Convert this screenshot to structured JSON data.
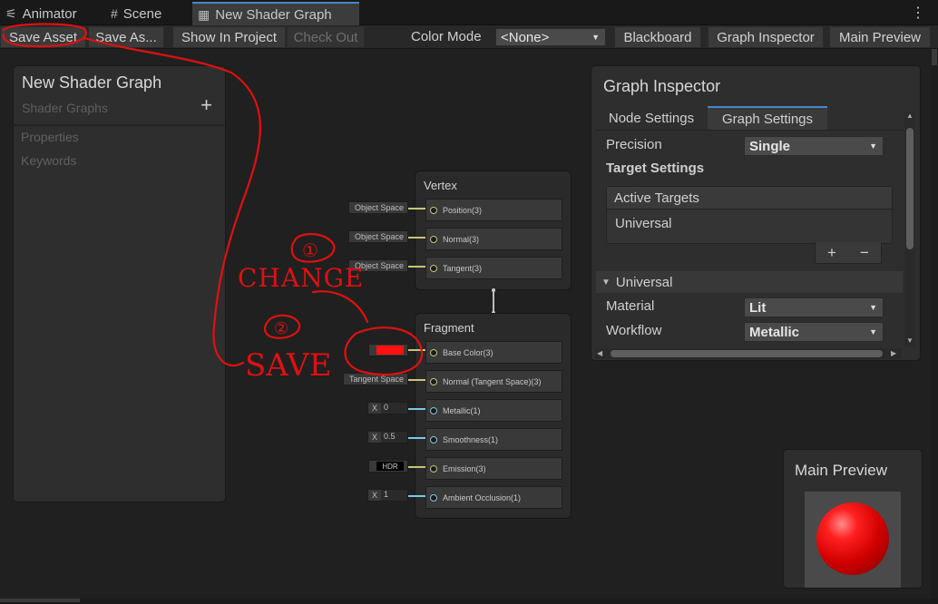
{
  "tabs": [
    {
      "icon": "animator-icon",
      "glyph": "⚟",
      "label": "Animator"
    },
    {
      "icon": "scene-icon",
      "glyph": "#",
      "label": "Scene"
    },
    {
      "icon": "shader-graph-icon",
      "glyph": "▦",
      "label": "New Shader Graph"
    }
  ],
  "toolbar": {
    "save_asset": "Save Asset",
    "save_as": "Save As...",
    "show_in_project": "Show In Project",
    "check_out": "Check Out",
    "color_mode_label": "Color Mode",
    "color_mode_value": "<None>",
    "blackboard": "Blackboard",
    "graph_inspector": "Graph Inspector",
    "main_preview": "Main Preview"
  },
  "blackboard": {
    "title": "New Shader Graph",
    "subtitle": "Shader Graphs",
    "properties": "Properties",
    "keywords": "Keywords"
  },
  "vertex": {
    "title": "Vertex",
    "blocks": [
      {
        "label": "Position(3)",
        "input": "Object Space"
      },
      {
        "label": "Normal(3)",
        "input": "Object Space"
      },
      {
        "label": "Tangent(3)",
        "input": "Object Space"
      }
    ]
  },
  "fragment": {
    "title": "Fragment",
    "blocks": [
      {
        "label": "Base Color(3)",
        "input": "",
        "input_color": "#ff1111"
      },
      {
        "label": "Normal (Tangent Space)(3)",
        "input": "Tangent Space"
      },
      {
        "label": "Metallic(1)",
        "input_prefix": "X",
        "input": "0"
      },
      {
        "label": "Smoothness(1)",
        "input_prefix": "X",
        "input": "0.5"
      },
      {
        "label": "Emission(3)",
        "input": "HDR"
      },
      {
        "label": "Ambient Occlusion(1)",
        "input_prefix": "X",
        "input": "1"
      }
    ]
  },
  "annotations": {
    "step1": "①",
    "step1_text": "CHANGE",
    "step2": "②",
    "step2_text": "SAVE",
    "color": "#e01010"
  },
  "inspector": {
    "title": "Graph Inspector",
    "tab_node": "Node Settings",
    "tab_graph": "Graph Settings",
    "precision_label": "Precision",
    "precision_value": "Single",
    "target_settings": "Target Settings",
    "active_targets": "Active Targets",
    "active_target_item": "Universal",
    "add": "+",
    "remove": "−",
    "universal_section": "Universal",
    "material_label": "Material",
    "material_value": "Lit",
    "workflow_label": "Workflow",
    "workflow_value": "Metallic"
  },
  "preview": {
    "title": "Main Preview"
  }
}
